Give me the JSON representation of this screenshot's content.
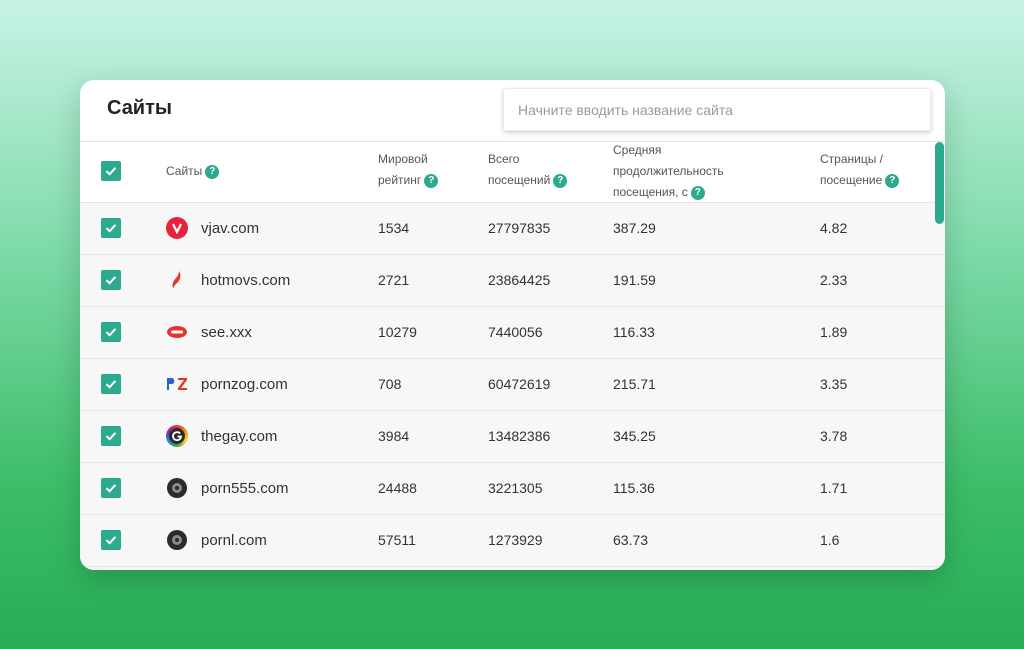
{
  "title": "Сайты",
  "search": {
    "placeholder": "Начните вводить название сайта"
  },
  "columns": {
    "site": "Сайты",
    "rank_l1": "Мировой",
    "rank_l2": "рейтинг",
    "visits_l1": "Всего",
    "visits_l2": "посещений",
    "duration_l1": "Средняя",
    "duration_l2": "продолжительность",
    "duration_l3": "посещения, с",
    "pages_l1": "Страницы /",
    "pages_l2": "посещение"
  },
  "help_glyph": "?",
  "rows": [
    {
      "site": "vjav.com",
      "rank": "1534",
      "visits": "27797835",
      "duration": "387.29",
      "pages": "4.82",
      "favicon": "v-red-circle-icon"
    },
    {
      "site": "hotmovs.com",
      "rank": "2721",
      "visits": "23864425",
      "duration": "191.59",
      "pages": "2.33",
      "favicon": "red-flame-icon"
    },
    {
      "site": "see.xxx",
      "rank": "10279",
      "visits": "7440056",
      "duration": "116.33",
      "pages": "1.89",
      "favicon": "red-badge-icon"
    },
    {
      "site": "pornzog.com",
      "rank": "708",
      "visits": "60472619",
      "duration": "215.71",
      "pages": "3.35",
      "favicon": "pz-letters-icon"
    },
    {
      "site": "thegay.com",
      "rank": "3984",
      "visits": "13482386",
      "duration": "345.25",
      "pages": "3.78",
      "favicon": "rainbow-g-icon"
    },
    {
      "site": "porn555.com",
      "rank": "24488",
      "visits": "3221305",
      "duration": "115.36",
      "pages": "1.71",
      "favicon": "dark-disc-icon"
    },
    {
      "site": "pornl.com",
      "rank": "57511",
      "visits": "1273929",
      "duration": "63.73",
      "pages": "1.6",
      "favicon": "dark-disc-icon"
    }
  ],
  "colors": {
    "accent": "#2baa8e",
    "row_bg": "#f7f7f7"
  }
}
